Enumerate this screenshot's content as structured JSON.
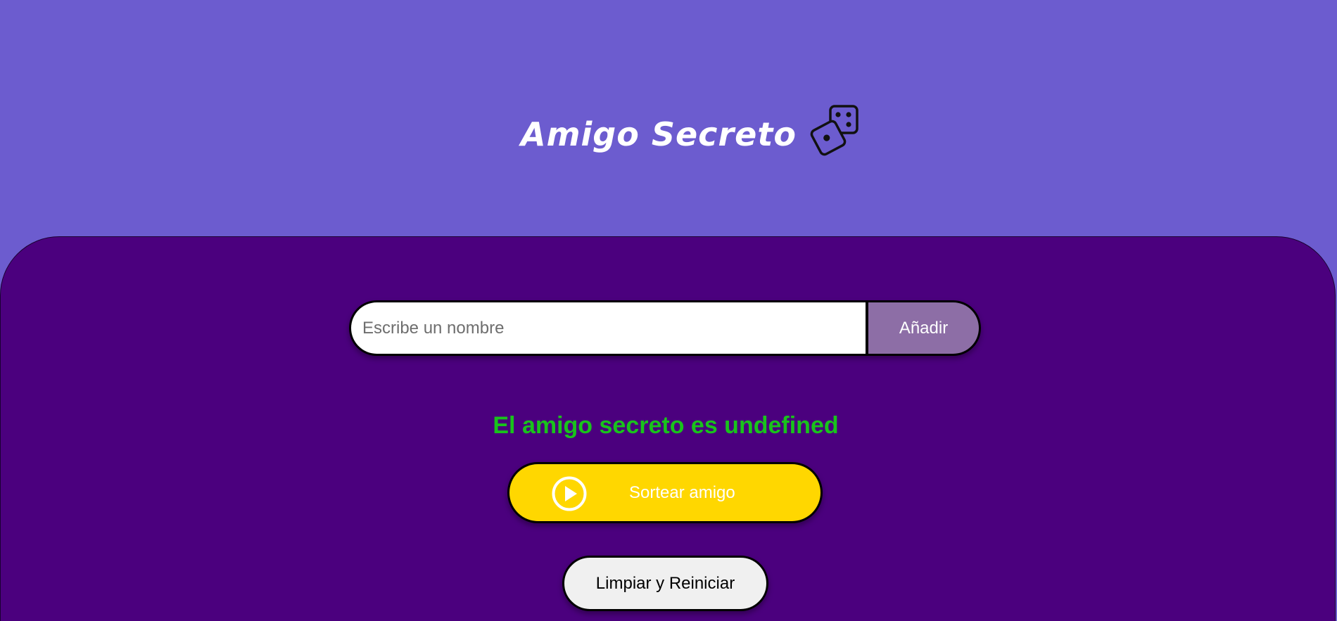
{
  "header": {
    "title": "Amigo Secreto",
    "icon": "dice-icon",
    "background_color": "#6c5ccf"
  },
  "form": {
    "input_placeholder": "Escribe un nombre",
    "input_value": "",
    "add_label": "Añadir",
    "add_color": "#8d6ea6"
  },
  "result": {
    "text": "El amigo secreto es undefined",
    "color": "#19c31c"
  },
  "actions": {
    "draw_label": "Sortear amigo",
    "draw_icon": "play-circle-icon",
    "draw_color": "#ffd700",
    "reset_label": "Limpiar y Reiniciar"
  },
  "main": {
    "background_color": "#4b007e"
  }
}
